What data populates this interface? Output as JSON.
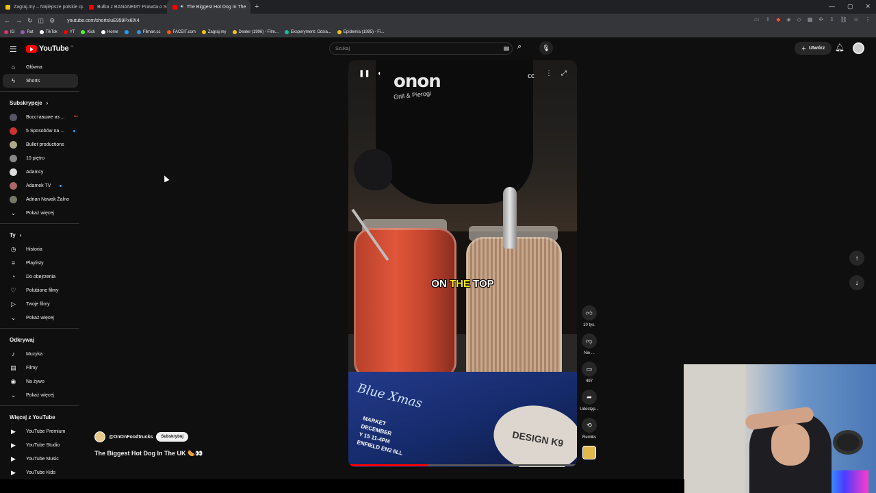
{
  "browser": {
    "tabs": [
      {
        "label": "Zagraj.my – Najlepsze polskie quizy",
        "active": false,
        "color": "#f1c40f"
      },
      {
        "label": "Bułka z BANANEM? Prawda o Sukces",
        "active": false,
        "color": "#ff0000"
      },
      {
        "label": "The Biggest Hot Dog In The",
        "active": true,
        "color": "#ff0000"
      }
    ],
    "url": "youtube.com/shorts/uE959Px6lX4",
    "bookmarks": [
      {
        "label": "IG",
        "color": "#e1306c"
      },
      {
        "label": "Rat",
        "color": "#9b59b6"
      },
      {
        "label": "TikTok",
        "color": "#ffffff"
      },
      {
        "label": "YT",
        "color": "#ff0000"
      },
      {
        "label": "Kick",
        "color": "#53fc18"
      },
      {
        "label": "Home",
        "color": "#ffffff"
      },
      {
        "label": "",
        "color": "#1da1f2"
      },
      {
        "label": "Filman.cc",
        "color": "#3498db"
      },
      {
        "label": "FACEIT.com",
        "color": "#ff5500"
      },
      {
        "label": "Zagraj.my",
        "color": "#f1c40f"
      },
      {
        "label": "Dealer (1996) - Film...",
        "color": "#f5c518"
      },
      {
        "label": "Eksperyment: Odsia...",
        "color": "#1abc9c"
      },
      {
        "label": "Epidemia (1995) - Fi...",
        "color": "#f5c518"
      }
    ]
  },
  "header": {
    "logo": "YouTube",
    "logo_region": "PL",
    "search_placeholder": "Szukaj",
    "create_label": "Utwórz"
  },
  "sidebar": {
    "main": [
      {
        "label": "Główna",
        "icon": "home-icon",
        "glyph": "⌂",
        "selected": false
      },
      {
        "label": "Shorts",
        "icon": "shorts-icon",
        "glyph": "ϟ",
        "selected": true
      }
    ],
    "subscriptions_title": "Subskrypcje",
    "subscriptions": [
      {
        "label": "Восставшие из ...",
        "color": "#556",
        "live": "•••"
      },
      {
        "label": "5 Sposobów na ...",
        "color": "#c33",
        "dot": true
      },
      {
        "label": "Bullet productions",
        "color": "#aa8"
      },
      {
        "label": "10 piętro",
        "color": "#888"
      },
      {
        "label": "Adamcy",
        "color": "#ddd"
      },
      {
        "label": "Adamek TV",
        "color": "#a66",
        "dot": true
      },
      {
        "label": "Adrian Nowak Żalno",
        "color": "#776"
      }
    ],
    "show_more": "Pokaż więcej",
    "you_title": "Ty",
    "you": [
      {
        "label": "Historia",
        "icon": "history-icon",
        "glyph": "◷"
      },
      {
        "label": "Playlisty",
        "icon": "playlist-icon",
        "glyph": "≡"
      },
      {
        "label": "Do obejrzenia",
        "icon": "watch-later-icon",
        "glyph": "◔"
      },
      {
        "label": "Polubione filmy",
        "icon": "like-icon",
        "glyph": "♡"
      },
      {
        "label": "Twoje filmy",
        "icon": "your-videos-icon",
        "glyph": "▷"
      }
    ],
    "explore_title": "Odkrywaj",
    "explore": [
      {
        "label": "Muzyka",
        "icon": "music-icon",
        "glyph": "♪"
      },
      {
        "label": "Filmy",
        "icon": "movies-icon",
        "glyph": "▤"
      },
      {
        "label": "Na żywo",
        "icon": "live-icon",
        "glyph": "◉"
      }
    ],
    "more_title": "Więcej z YouTube",
    "more": [
      {
        "label": "YouTube Premium"
      },
      {
        "label": "YouTube Studio"
      },
      {
        "label": "YouTube Music"
      },
      {
        "label": "YouTube Kids"
      }
    ]
  },
  "short": {
    "channel": "@OnOnFoodtrucks",
    "subscribe_label": "Subskrybuj",
    "title": "The Biggest Hot Dog In The UK 🌭👀",
    "caption_parts": [
      "ON ",
      "THE",
      " TOP"
    ],
    "shirt_logo": "onon",
    "shirt_sub": "Grill & Pierogi",
    "flyer_title": "Blue Xmas",
    "flyer_lines": [
      "MARKET",
      "DECEMBER",
      "Y 15 11-4PM",
      "ENFIELD EN2 6LL"
    ],
    "badge_text": "DESIGN K9",
    "progress": 0.35,
    "likes": "10 tys.",
    "dislike_label": "Nie ...",
    "comments": "497",
    "share_label": "Udostęp...",
    "remix_label": "Remiks"
  }
}
